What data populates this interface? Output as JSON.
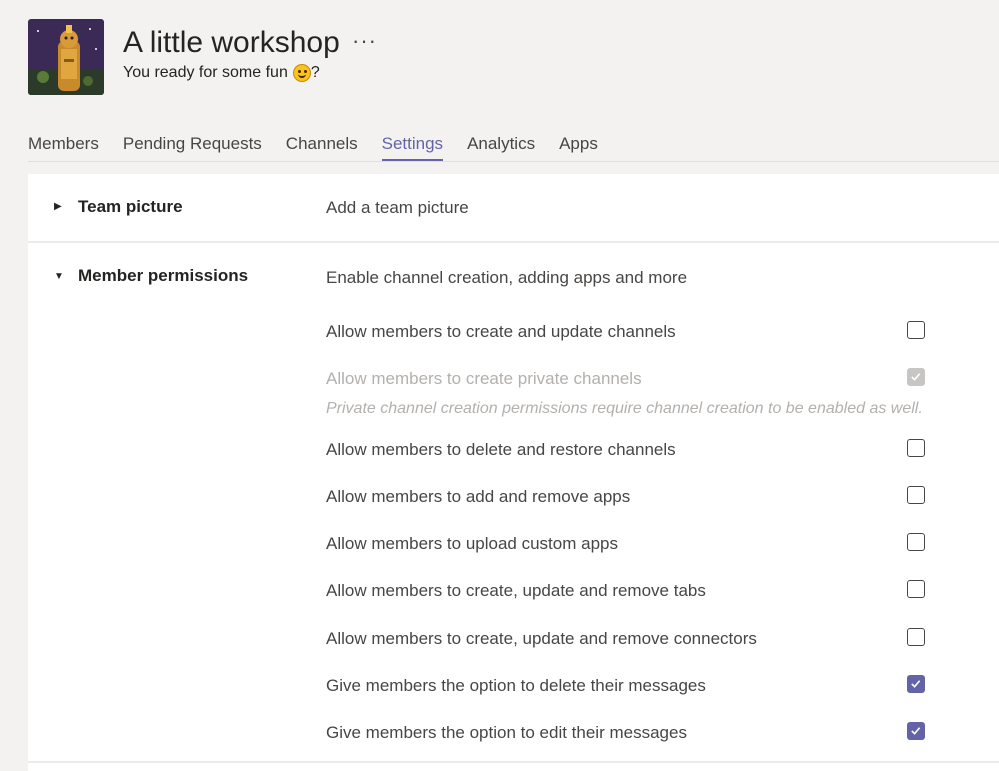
{
  "team": {
    "name": "A little workshop",
    "more_icon": "···",
    "subtitle": "You ready for some fun",
    "subtitle_suffix": "?"
  },
  "tabs": [
    {
      "label": "Members",
      "active": false
    },
    {
      "label": "Pending Requests",
      "active": false
    },
    {
      "label": "Channels",
      "active": false
    },
    {
      "label": "Settings",
      "active": true
    },
    {
      "label": "Analytics",
      "active": false
    },
    {
      "label": "Apps",
      "active": false
    }
  ],
  "settings": {
    "team_picture": {
      "title": "Team picture",
      "description": "Add a team picture",
      "expanded": false
    },
    "member_permissions": {
      "title": "Member permissions",
      "description": "Enable channel creation, adding apps and more",
      "expanded": true,
      "options": [
        {
          "label": "Allow members to create and update channels",
          "checked": false,
          "disabled": false
        },
        {
          "label": "Allow members to create private channels",
          "checked": true,
          "disabled": true
        },
        {
          "label": "Allow members to delete and restore channels",
          "checked": false,
          "disabled": false
        },
        {
          "label": "Allow members to add and remove apps",
          "checked": false,
          "disabled": false
        },
        {
          "label": "Allow members to upload custom apps",
          "checked": false,
          "disabled": false
        },
        {
          "label": "Allow members to create, update and remove tabs",
          "checked": false,
          "disabled": false
        },
        {
          "label": "Allow members to create, update and remove connectors",
          "checked": false,
          "disabled": false
        },
        {
          "label": "Give members the option to delete their messages",
          "checked": true,
          "disabled": false
        },
        {
          "label": "Give members the option to edit their messages",
          "checked": true,
          "disabled": false
        }
      ],
      "private_channel_note": "Private channel creation permissions require channel creation to be enabled as well."
    }
  },
  "colors": {
    "accent": "#6264a7",
    "background": "#f3f2f1",
    "panel": "#ffffff"
  }
}
